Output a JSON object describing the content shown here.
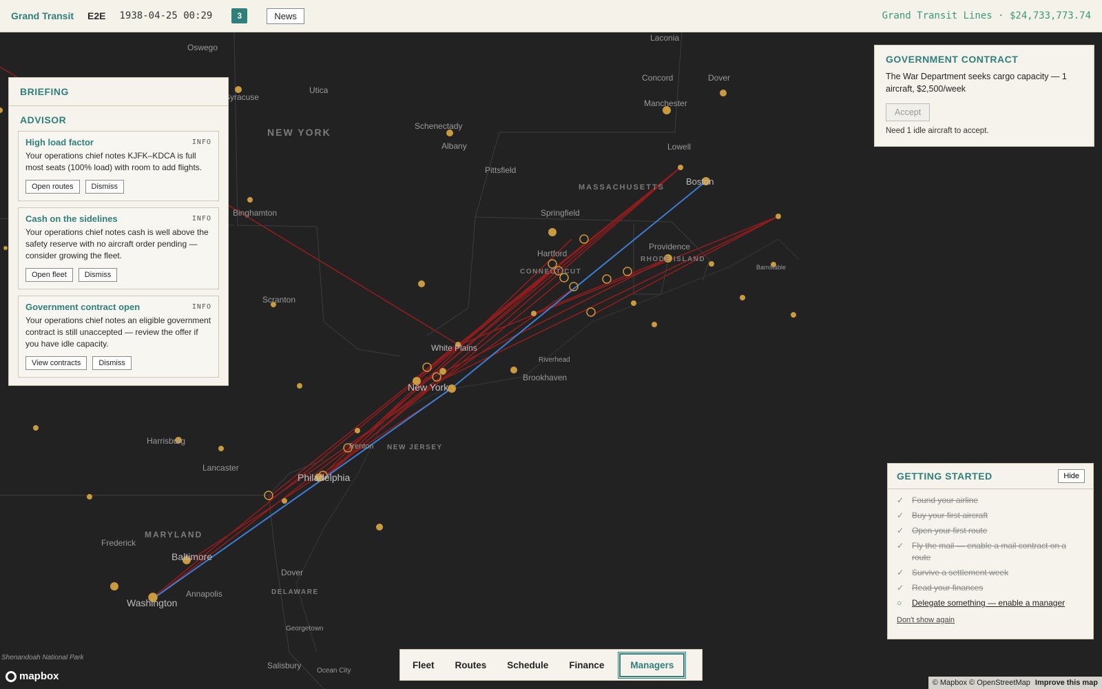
{
  "topbar": {
    "brand": "Grand Transit",
    "code": "E2E",
    "datetime": "1938-04-25 00:29",
    "badge_count": "3",
    "news_label": "News",
    "airline_cash": "Grand Transit Lines · $24,733,773.74"
  },
  "colors": {
    "accent": "#2f7f7b",
    "cash": "#3a9a76",
    "route_red": "#8f1d1d",
    "route_blue": "#3d7fd6",
    "airport_gold": "#c99a3f"
  },
  "briefing": {
    "title": "BRIEFING",
    "advisor_title": "ADVISOR",
    "cards": [
      {
        "title": "High load factor",
        "tag": "INFO",
        "body": "Your operations chief notes KJFK–KDCA is full most seats (100% load) with room to add flights.",
        "action": "Open routes",
        "dismiss": "Dismiss"
      },
      {
        "title": "Cash on the sidelines",
        "tag": "INFO",
        "body": "Your operations chief notes cash is well above the safety reserve with no aircraft order pending — consider growing the fleet.",
        "action": "Open fleet",
        "dismiss": "Dismiss"
      },
      {
        "title": "Government contract open",
        "tag": "INFO",
        "body": "Your operations chief notes an eligible government contract is still unaccepted — review the offer if you have idle capacity.",
        "action": "View contracts",
        "dismiss": "Dismiss"
      }
    ]
  },
  "contract": {
    "title": "GOVERNMENT CONTRACT",
    "description": "The War Department seeks cargo capacity — 1 aircraft, $2,500/week",
    "accept_label": "Accept",
    "note": "Need 1 idle aircraft to accept."
  },
  "getting_started": {
    "title": "GETTING STARTED",
    "hide_label": "Hide",
    "tasks": [
      {
        "label": "Found your airline",
        "done": true
      },
      {
        "label": "Buy your first aircraft",
        "done": true
      },
      {
        "label": "Open your first route",
        "done": true
      },
      {
        "label": "Fly the mail — enable a mail contract on a route",
        "done": true
      },
      {
        "label": "Survive a settlement week",
        "done": true
      },
      {
        "label": "Read your finances",
        "done": true
      },
      {
        "label": "Delegate something — enable a manager",
        "done": false
      }
    ],
    "done_mark": "✓",
    "todo_mark": "○",
    "dont_show": "Don't show again"
  },
  "nav": {
    "items": [
      "Fleet",
      "Routes",
      "Schedule",
      "Finance",
      "Managers"
    ],
    "active": "Managers"
  },
  "map": {
    "labels": [
      "Oswego",
      "Laconia",
      "Utica",
      "Syracuse",
      "Concord",
      "Dover",
      "NEW YORK",
      "Schenectady",
      "Manchester",
      "Albany",
      "Lowell",
      "Pittsfield",
      "Boston",
      "MASSACHUSETTS",
      "Binghamton",
      "Springfield",
      "Providence",
      "Hartford",
      "CONNECTICUT",
      "RHODE ISLAND",
      "Barnstable",
      "Scranton",
      "White Plains",
      "Riverhead",
      "Brookhaven",
      "New York",
      "Harrisburg",
      "Trenton",
      "NEW JERSEY",
      "Lancaster",
      "Philadelphia",
      "MARYLAND",
      "Frederick",
      "Baltimore",
      "Dover",
      "DELAWARE",
      "Annapolis",
      "Washington",
      "Georgetown",
      "Shenandoah National Park",
      "Salisbury",
      "Ocean City"
    ],
    "attribution": "© Mapbox © OpenStreetMap",
    "improve": "Improve this map",
    "logo": "mapbox"
  }
}
